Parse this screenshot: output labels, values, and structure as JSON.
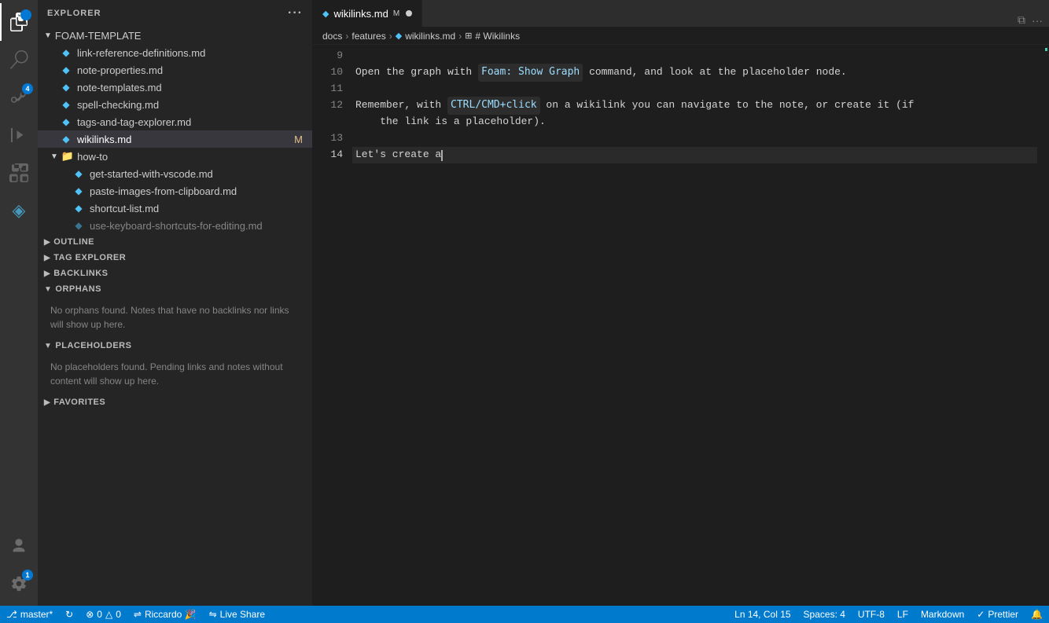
{
  "activityBar": {
    "icons": [
      {
        "name": "files-icon",
        "symbol": "⎘",
        "active": true,
        "badge": null
      },
      {
        "name": "search-icon",
        "symbol": "🔍",
        "active": false,
        "badge": null
      },
      {
        "name": "source-control-icon",
        "symbol": "⑂",
        "active": false,
        "badge": "4"
      },
      {
        "name": "run-icon",
        "symbol": "▷",
        "active": false,
        "badge": null
      },
      {
        "name": "extensions-icon",
        "symbol": "⊞",
        "active": false,
        "badge": null
      },
      {
        "name": "foam-icon",
        "symbol": "◈",
        "active": false,
        "badge": null
      }
    ],
    "bottomIcons": [
      {
        "name": "account-icon",
        "symbol": "👤"
      },
      {
        "name": "settings-icon",
        "symbol": "⚙",
        "badge": "1"
      }
    ]
  },
  "sidebar": {
    "title": "EXPLORER",
    "rootFolder": "FOAM-TEMPLATE",
    "files": [
      {
        "name": "link-reference-definitions.md",
        "type": "file",
        "indent": 20
      },
      {
        "name": "note-properties.md",
        "type": "file",
        "indent": 20
      },
      {
        "name": "note-templates.md",
        "type": "file",
        "indent": 20
      },
      {
        "name": "spell-checking.md",
        "type": "file",
        "indent": 20
      },
      {
        "name": "tags-and-tag-explorer.md",
        "type": "file",
        "indent": 20
      },
      {
        "name": "wikilinks.md",
        "type": "file",
        "indent": 20,
        "active": true,
        "modified": true
      }
    ],
    "howToFolder": {
      "name": "how-to",
      "files": [
        {
          "name": "get-started-with-vscode.md",
          "type": "file",
          "indent": 36
        },
        {
          "name": "paste-images-from-clipboard.md",
          "type": "file",
          "indent": 36
        },
        {
          "name": "shortcut-list.md",
          "type": "file",
          "indent": 36
        },
        {
          "name": "use-keyboard-shortcuts-for-editing.md",
          "type": "file",
          "indent": 36
        }
      ]
    },
    "sections": [
      {
        "name": "OUTLINE",
        "collapsed": true
      },
      {
        "name": "TAG EXPLORER",
        "collapsed": true
      },
      {
        "name": "BACKLINKS",
        "collapsed": true
      },
      {
        "name": "ORPHANS",
        "collapsed": false,
        "content": "No orphans found. Notes that have no backlinks nor links will show up here."
      },
      {
        "name": "PLACEHOLDERS",
        "collapsed": false,
        "content": "No placeholders found. Pending links and notes without content will show up here."
      },
      {
        "name": "FAVORITES",
        "collapsed": true
      }
    ]
  },
  "editor": {
    "tab": {
      "filename": "wikilinks.md",
      "icon": "foam",
      "modified": true,
      "unsavedDot": true
    },
    "breadcrumb": {
      "parts": [
        "docs",
        "features",
        "wikilinks.md",
        "# Wikilinks"
      ]
    },
    "lines": [
      {
        "num": 9,
        "content": ""
      },
      {
        "num": 10,
        "content": "Open the graph with `Foam: Show Graph` command, and look at the placeholder node."
      },
      {
        "num": 11,
        "content": ""
      },
      {
        "num": 12,
        "content": "Remember, with `CTRL/CMD+click` on a wikilink you can navigate to the note, or create it (if"
      },
      {
        "num": 12,
        "content_cont": "    the link is a placeholder)."
      },
      {
        "num": 13,
        "content": ""
      },
      {
        "num": 14,
        "content": "Let's create a",
        "cursor": true
      }
    ]
  },
  "statusBar": {
    "left": [
      {
        "name": "git-branch",
        "icon": "⎇",
        "label": "master*"
      },
      {
        "name": "sync",
        "icon": "↻",
        "label": ""
      },
      {
        "name": "errors",
        "icon": "⊗",
        "label": "0"
      },
      {
        "name": "warnings",
        "icon": "△",
        "label": "0"
      },
      {
        "name": "live-share",
        "icon": "⇌",
        "label": "Riccardo 🎉"
      },
      {
        "name": "live-share-label",
        "icon": "⇋",
        "label": "Live Share"
      }
    ],
    "right": [
      {
        "name": "cursor-position",
        "label": "Ln 14, Col 15"
      },
      {
        "name": "spaces",
        "label": "Spaces: 4"
      },
      {
        "name": "encoding",
        "label": "UTF-8"
      },
      {
        "name": "line-ending",
        "label": "LF"
      },
      {
        "name": "language",
        "label": "Markdown"
      },
      {
        "name": "prettier",
        "icon": "✓",
        "label": "Prettier"
      },
      {
        "name": "feedback",
        "icon": "🔔",
        "label": ""
      }
    ]
  }
}
